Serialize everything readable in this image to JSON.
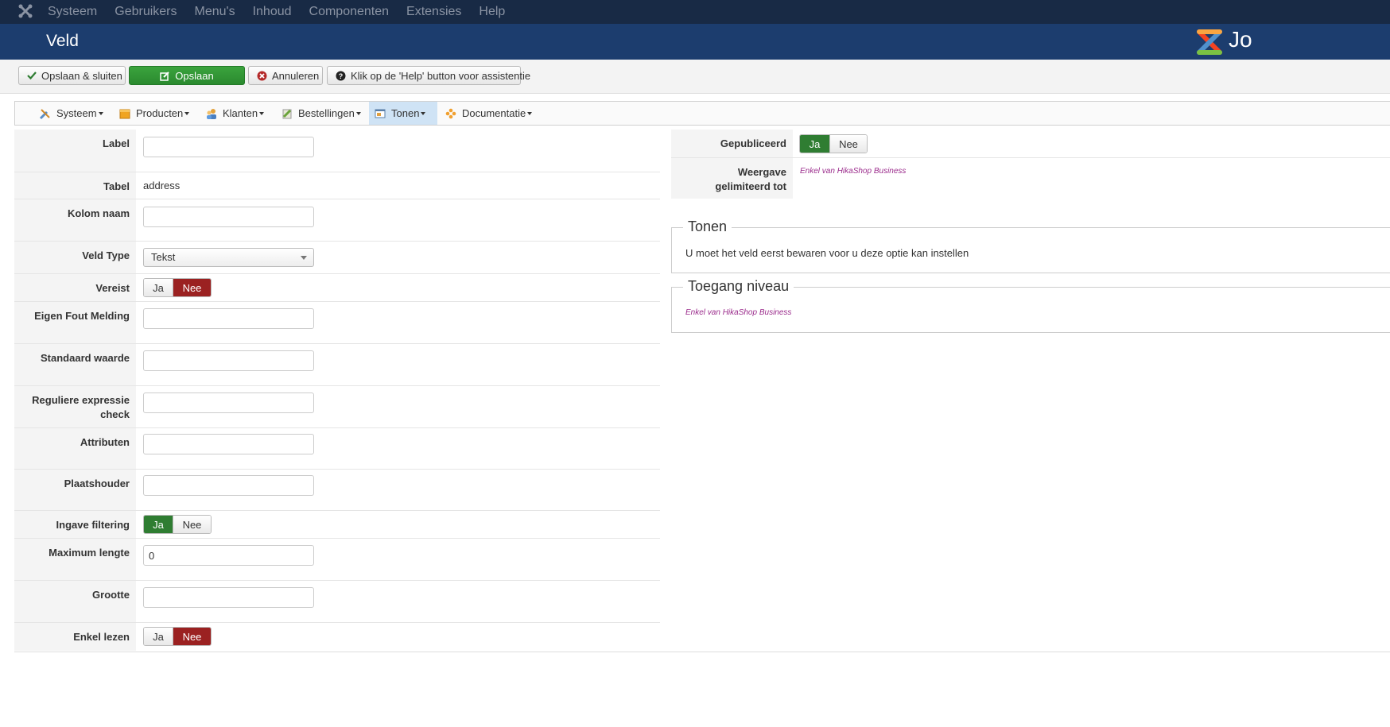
{
  "topnav": {
    "items": [
      "Systeem",
      "Gebruikers",
      "Menu's",
      "Inhoud",
      "Componenten",
      "Extensies",
      "Help"
    ]
  },
  "header": {
    "title": "Veld",
    "brand_text": "Jo"
  },
  "toolbar": {
    "save_close": "Opslaan & sluiten",
    "save": "Opslaan",
    "cancel": "Annuleren",
    "help": "Klik op de 'Help' button voor assistentie"
  },
  "menu": {
    "items": [
      "Systeem",
      "Producten",
      "Klanten",
      "Bestellingen",
      "Tonen",
      "Documentatie"
    ],
    "active": "Tonen"
  },
  "form": {
    "label": "Label",
    "tabel": "Tabel",
    "tabel_value": "address",
    "kolom": "Kolom naam",
    "veldtype": "Veld Type",
    "veldtype_value": "Tekst",
    "vereist": "Vereist",
    "fout": "Eigen Fout Melding",
    "standaard": "Standaard waarde",
    "regex_1": "Reguliere expressie",
    "regex_2": "check",
    "attributen": "Attributen",
    "plaatshouder": "Plaatshouder",
    "ingave": "Ingave filtering",
    "maxlengte": "Maximum lengte",
    "maxlengte_value": "0",
    "grootte": "Grootte",
    "enkel": "Enkel lezen",
    "ja": "Ja",
    "nee": "Nee"
  },
  "right": {
    "gepubliceerd": "Gepubliceerd",
    "weergave_1": "Weergave",
    "weergave_2": "gelimiteerd tot",
    "business_note": "Enkel van HikaShop Business",
    "tonen_title": "Tonen",
    "tonen_text": "U moet het veld eerst bewaren voor u deze optie kan instellen",
    "toegang_title": "Toegang niveau",
    "toegang_note": "Enkel van HikaShop Business"
  },
  "colors": {
    "green": "#2f7d32",
    "red": "#9b2121",
    "header_blue": "#1c3d6e",
    "topnav": "#182a45",
    "note_purple": "#9b2c8c"
  }
}
